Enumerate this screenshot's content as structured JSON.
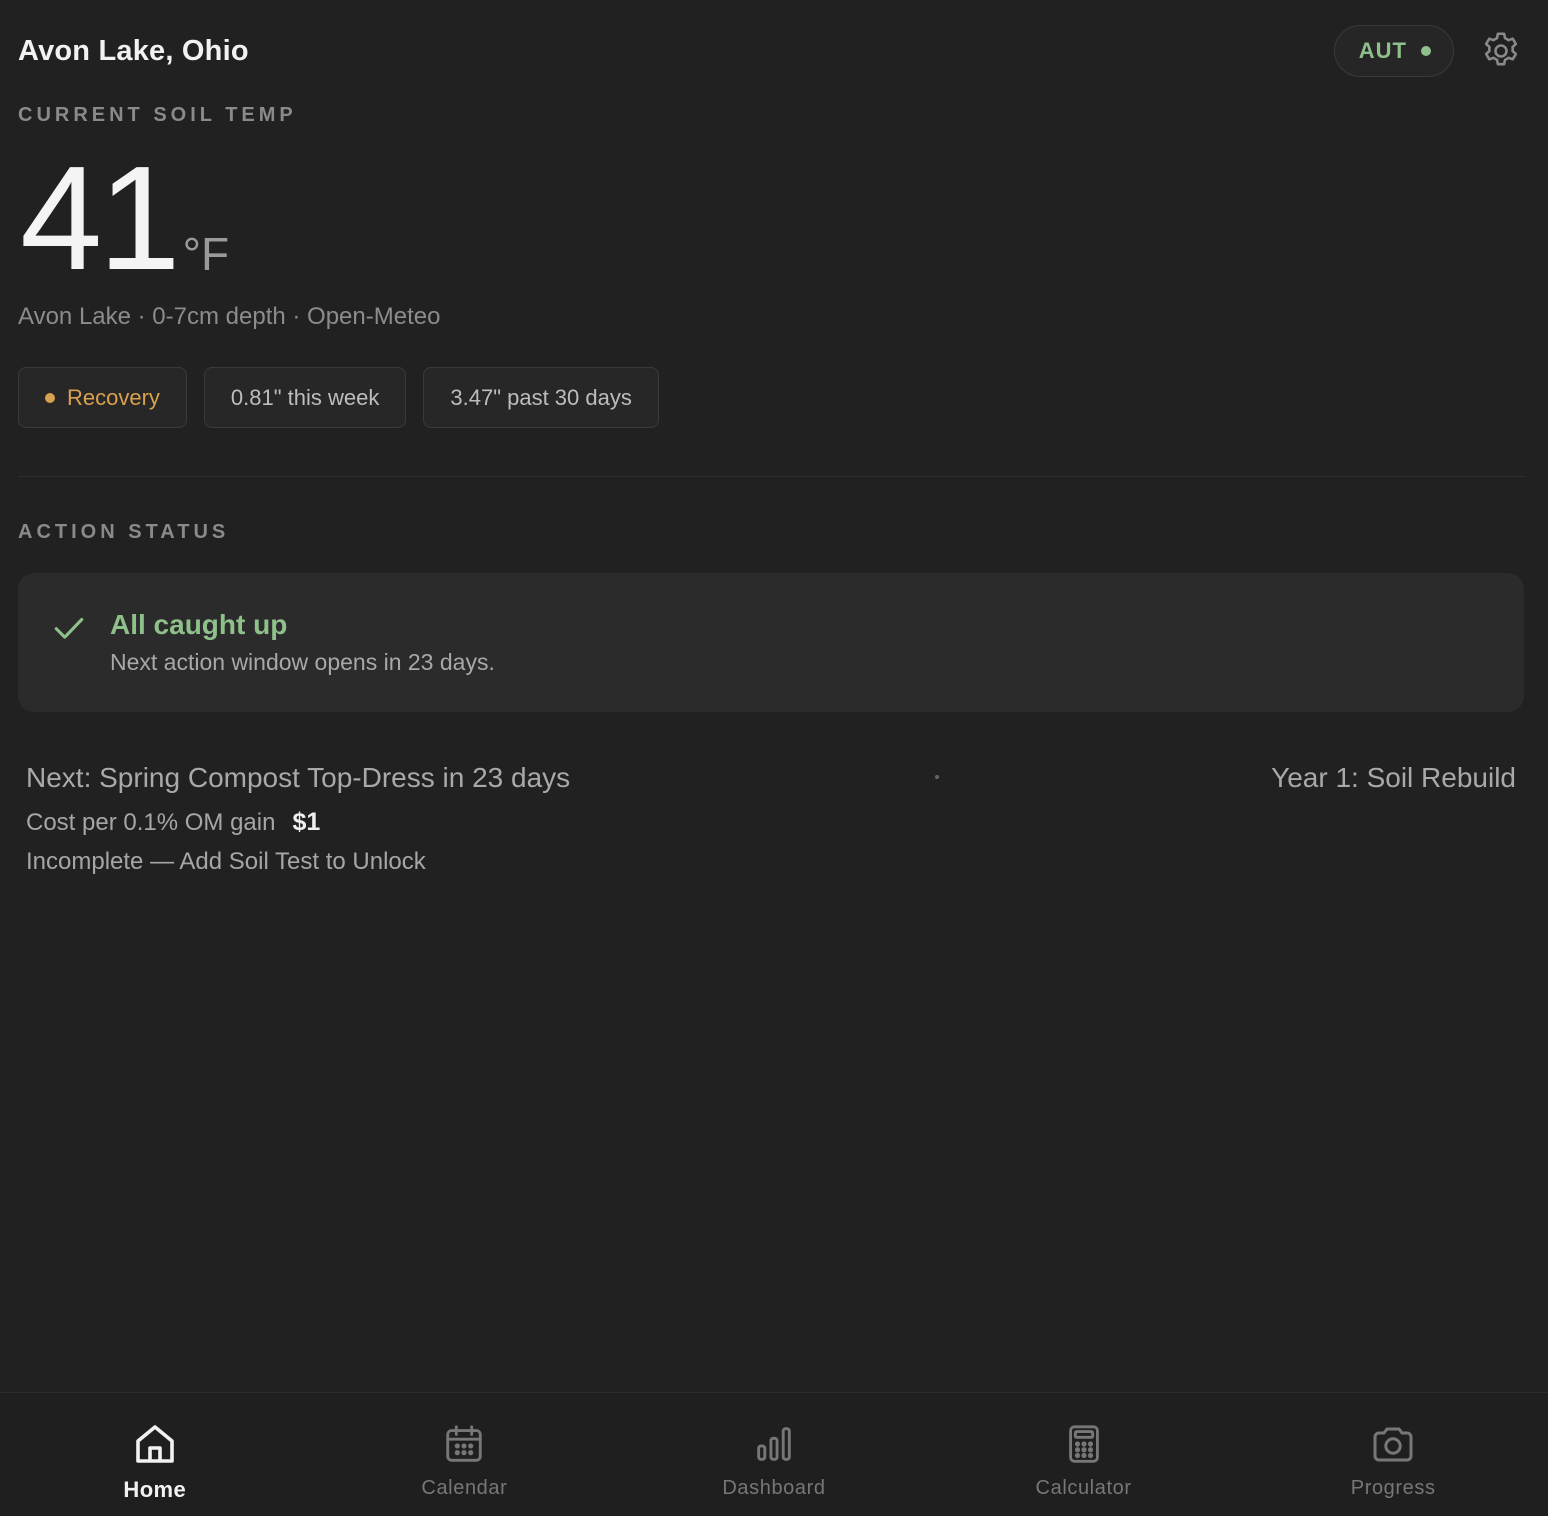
{
  "header": {
    "location": "Avon Lake, Ohio",
    "mode_label": "AUT"
  },
  "soil": {
    "section_label": "CURRENT SOIL TEMP",
    "temperature": "41",
    "unit": "°F",
    "source": "Avon Lake · 0-7cm depth · Open-Meteo",
    "chips": [
      {
        "label": "Recovery",
        "color": "#d9a04e"
      },
      {
        "label": "0.81\" this week"
      },
      {
        "label": "3.47\" past 30 days"
      }
    ]
  },
  "action": {
    "section_label": "ACTION STATUS",
    "title": "All caught up",
    "subtitle": "Next action window opens in 23 days."
  },
  "plan": {
    "next": "Next: Spring Compost Top-Dress in 23 days",
    "phase": "Year 1: Soil Rebuild",
    "cost_label": "Cost per 0.1% OM gain",
    "cost_value": "$1",
    "incomplete": "Incomplete — Add Soil Test to Unlock"
  },
  "nav": {
    "items": [
      {
        "label": "Home",
        "icon": "home-icon",
        "active": true
      },
      {
        "label": "Calendar",
        "icon": "calendar-icon"
      },
      {
        "label": "Dashboard",
        "icon": "bar-chart-icon"
      },
      {
        "label": "Calculator",
        "icon": "calculator-icon"
      },
      {
        "label": "Progress",
        "icon": "camera-icon"
      }
    ]
  },
  "colors": {
    "background": "#212121",
    "accent_green": "#8fbf8a",
    "warning_amber": "#d9a04e"
  }
}
